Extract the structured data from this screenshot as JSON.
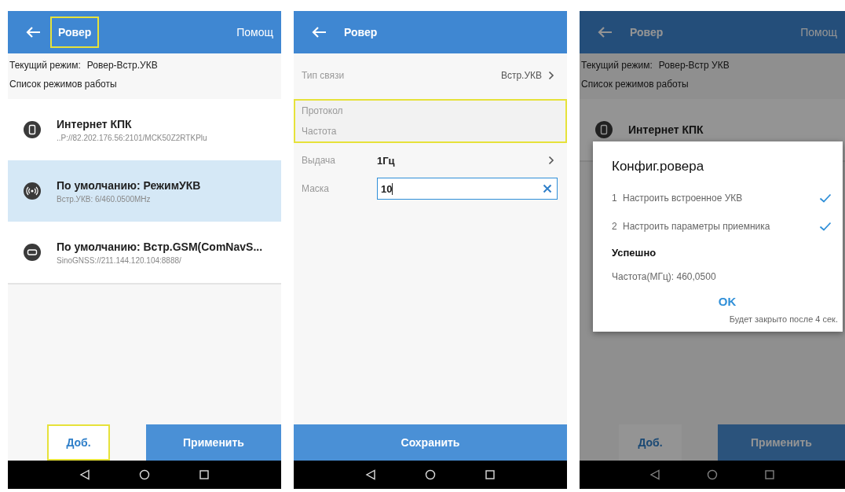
{
  "phones": [
    {
      "kind": "mode_list",
      "dimmed": false,
      "header": {
        "title": "Ровер",
        "title_highlighted": true,
        "help": "Помощ"
      },
      "current_mode": {
        "label": "Текущий режим:",
        "value": "Ровер-Встр.УКВ"
      },
      "list_title": "Список режимов работы",
      "modes": [
        {
          "kind": "phone",
          "title": "Интернет КПК",
          "subtitle": "..P://82.202.176.56:2101/MCK50Z2RTKPlu",
          "selected": false
        },
        {
          "kind": "radio",
          "title": "По умолчанию: РежимУКВ",
          "subtitle": "Встр.УКВ: 6/460.0500MHz",
          "selected": true
        },
        {
          "kind": "modem",
          "title": "По умолчанию: Встр.GSM(ComNavS...",
          "subtitle": "SinoGNSS://211.144.120.104:8888/",
          "selected": false
        }
      ],
      "buttons": [
        {
          "label": "Доб.",
          "kind": "secondary",
          "highlighted": true
        },
        {
          "label": "Применить",
          "kind": "primary",
          "highlighted": false
        }
      ]
    },
    {
      "kind": "settings_form",
      "dimmed": false,
      "header": {
        "title": "Ровер",
        "title_highlighted": false
      },
      "row_groups": [
        {
          "highlighted": false,
          "rows": [
            {
              "kind": "select",
              "label": "Тип связи",
              "value": "Встр.УКВ"
            }
          ]
        },
        {
          "highlighted": true,
          "rows": [
            {
              "kind": "info",
              "label": "Протокол"
            },
            {
              "kind": "info",
              "label": "Частота"
            }
          ]
        },
        {
          "highlighted": false,
          "rows": [
            {
              "kind": "select_inline",
              "label": "Выдача",
              "value": "1Гц"
            },
            {
              "kind": "input",
              "label": "Маска",
              "value": "10",
              "focused": true
            }
          ]
        }
      ],
      "buttons": [
        {
          "label": "Сохранить",
          "kind": "primary",
          "highlighted": false
        }
      ]
    },
    {
      "kind": "mode_list",
      "dimmed": true,
      "header": {
        "title": "Ровер",
        "title_highlighted": false,
        "help": "Помощ"
      },
      "current_mode": {
        "label": "Текущий режим:",
        "value": "Ровер-Встр УКВ"
      },
      "list_title": "Список режимов работы",
      "modes": [
        {
          "kind": "phone",
          "title": "Интернет КПК",
          "selected": false
        }
      ],
      "buttons": [
        {
          "label": "Доб.",
          "kind": "secondary",
          "highlighted": false
        },
        {
          "label": "Применить",
          "kind": "primary",
          "highlighted": false
        }
      ],
      "dialog": {
        "title": "Конфиг.ровера",
        "steps": [
          {
            "number": "1",
            "label": "Настроить встроенное УКВ",
            "checked": true
          },
          {
            "number": "2",
            "label": "Настроить параметры приемника",
            "checked": true
          }
        ],
        "status": "Успешно",
        "frequency": "Частота(МГц):  460,0500",
        "ok": "OK",
        "note": "Будет закрыто после 4 сек."
      }
    }
  ]
}
